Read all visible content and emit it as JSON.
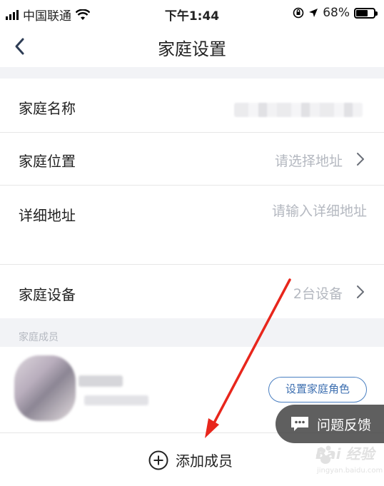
{
  "status_bar": {
    "carrier": "中国联通",
    "time": "下午1:44",
    "battery_percent": "68%",
    "battery_level": 0.68
  },
  "nav": {
    "title": "家庭设置"
  },
  "rows": {
    "name_label": "家庭名称",
    "location_label": "家庭位置",
    "location_placeholder": "请选择地址",
    "address_label": "详细地址",
    "address_placeholder": "请输入详细地址",
    "devices_label": "家庭设备",
    "devices_value": "2台设备"
  },
  "members": {
    "section_title": "家庭成员",
    "set_role_label": "设置家庭角色",
    "add_member_label": "添加成员"
  },
  "feedback": {
    "label": "问题反馈"
  },
  "watermark": {
    "text": "Bai 经验",
    "sub": "jingyan.baidu.com"
  },
  "colors": {
    "accent": "#3d6fb0",
    "placeholder": "#b4b8c0",
    "section_bg": "#f2f3f6",
    "annotation": "#e8261c"
  }
}
